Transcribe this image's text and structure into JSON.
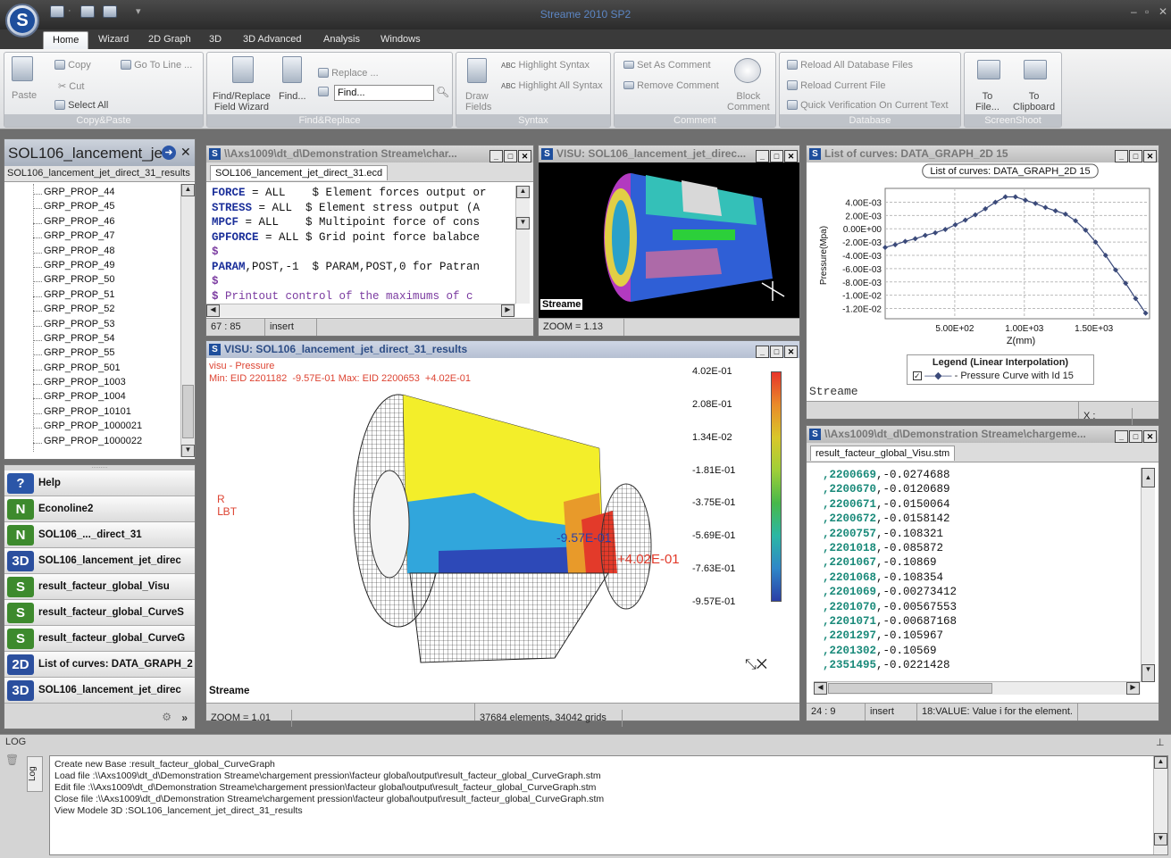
{
  "app": {
    "title": "Streame 2010 SP2",
    "logo_letter": "S"
  },
  "ribbon_tabs": [
    "Home",
    "Wizard",
    "2D Graph",
    "3D",
    "3D Advanced",
    "Analysis",
    "Windows"
  ],
  "ribbon": {
    "copy_paste": {
      "label": "Copy&Paste",
      "paste": "Paste",
      "copy": "Copy",
      "goto_line": "Go To Line ...",
      "cut": "Cut",
      "select_all": "Select All"
    },
    "find_replace": {
      "label": "Find&Replace",
      "find_replace_field_wizard": "Find/Replace\nField Wizard",
      "find": "Find...",
      "replace": "Replace ...",
      "find_input_value": "Find..."
    },
    "syntax": {
      "label": "Syntax",
      "draw_fields": "Draw\nFields",
      "highlight_syntax": "Highlight Syntax",
      "highlight_all_syntax": "Highlight All Syntax"
    },
    "comment": {
      "label": "Comment",
      "set_as_comment": "Set As Comment",
      "remove_comment": "Remove Comment",
      "block_comment": "Block\nComment"
    },
    "database": {
      "label": "Database",
      "reload_all": "Reload All Database Files",
      "reload_current": "Reload Current File",
      "quick_verification": "Quick Verification On Current Text"
    },
    "screenshoot": {
      "label": "ScreenShoot",
      "to_file": "To\nFile...",
      "to_clipboard": "To\nClipboard"
    }
  },
  "left_panel": {
    "title": "SOL106_lancement_je",
    "tab": "SOL106_lancement_jet_direct_31_results",
    "tree_items": [
      "GRP_PROP_44",
      "GRP_PROP_45",
      "GRP_PROP_46",
      "GRP_PROP_47",
      "GRP_PROP_48",
      "GRP_PROP_49",
      "GRP_PROP_50",
      "GRP_PROP_51",
      "GRP_PROP_52",
      "GRP_PROP_53",
      "GRP_PROP_54",
      "GRP_PROP_55",
      "GRP_PROP_501",
      "GRP_PROP_1003",
      "GRP_PROP_1004",
      "GRP_PROP_10101",
      "GRP_PROP_1000021",
      "GRP_PROP_1000022"
    ]
  },
  "nav_items": [
    {
      "icon": "?",
      "label": "Help",
      "color": "#2b56a8"
    },
    {
      "icon": "N",
      "label": "Econoline2",
      "color": "#3d8a2d"
    },
    {
      "icon": "N",
      "label": "SOL106_..._direct_31",
      "color": "#3d8a2d"
    },
    {
      "icon": "3D",
      "label": "SOL106_lancement_jet_direc",
      "color": "#2b4f9e"
    },
    {
      "icon": "S",
      "label": "result_facteur_global_Visu",
      "color": "#3d8a2d"
    },
    {
      "icon": "S",
      "label": "result_facteur_global_CurveS",
      "color": "#3d8a2d"
    },
    {
      "icon": "S",
      "label": "result_facteur_global_CurveG",
      "color": "#3d8a2d"
    },
    {
      "icon": "2D",
      "label": "List of curves: DATA_GRAPH_2",
      "color": "#2b4f9e"
    },
    {
      "icon": "3D",
      "label": "SOL106_lancement_jet_direc",
      "color": "#2b4f9e"
    }
  ],
  "editor": {
    "title": "\\\\Axs1009\\dt_d\\Demonstration Streame\\char...",
    "tab": "SOL106_lancement_jet_direct_31.ecd",
    "lines": [
      {
        "kw": "FORCE",
        "rest": " = ALL    $ Element forces output or"
      },
      {
        "kw": "STRESS",
        "rest": " = ALL  $ Element stress output (A"
      },
      {
        "kw": "MPCF",
        "rest": " = ALL    $ Multipoint force of cons"
      },
      {
        "kw": "GPFORCE",
        "rest": " = ALL $ Grid point force balabce"
      },
      {
        "kw": "$",
        "rest": ""
      },
      {
        "kw": "PARAM",
        "rest": ",POST,-1  $ PARAM,POST,0 for Patran"
      },
      {
        "kw": "$",
        "rest": ""
      },
      {
        "kw": "$",
        "rest": " Printout control of the maximums of c"
      }
    ],
    "status_pos": "67 : 85",
    "status_mode": "insert"
  },
  "visu_small": {
    "title": "VISU: SOL106_lancement_jet_direc...",
    "brand": "Streame",
    "zoom": "ZOOM = 1.13"
  },
  "visu_main": {
    "title": "VISU: SOL106_lancement_jet_direct_31_results",
    "subtitle": "visu - Pressure",
    "minmax": "Min: EID 2201182  -9.57E-01 Max: EID 2200653  +4.02E-01",
    "label_min": "-9.57E-01",
    "label_max": "+4.02E-01",
    "scale_values": [
      "4.02E-01",
      "2.08E-01",
      "1.34E-02",
      "-1.81E-01",
      "-3.75E-01",
      "-5.69E-01",
      "-7.63E-01",
      "-9.57E-01"
    ],
    "scale_colors": [
      "#e8352a",
      "#e98b2a",
      "#d9c72a",
      "#9fcf38",
      "#48b84a",
      "#2bb7a4",
      "#2f87c8",
      "#2b3fa6"
    ],
    "brand": "Streame",
    "zoom": "ZOOM = 1.01",
    "elements": "37684 elements, 34042 grids"
  },
  "curves": {
    "window_title": "List of curves: DATA_GRAPH_2D 15",
    "legend_title": "Legend (Linear Interpolation)",
    "legend_entry": "- Pressure Curve with Id 15",
    "brand": "Streame",
    "status_x": "X :"
  },
  "chart_data": {
    "type": "line",
    "title": "List of curves: DATA_GRAPH_2D 15",
    "xlabel": "Z(mm)",
    "ylabel": "Pressure(Mpa)",
    "xlim": [
      0,
      1900
    ],
    "ylim": [
      -0.013,
      0.005
    ],
    "x_ticks": [
      "5.00E+02",
      "1.00E+03",
      "1.50E+03"
    ],
    "x_tick_values": [
      500,
      1000,
      1500
    ],
    "y_ticks": [
      "4.00E-03",
      "2.00E-03",
      "0.00E+00",
      "-2.00E-03",
      "-4.00E-03",
      "-6.00E-03",
      "-8.00E-03",
      "-1.00E-02",
      "-1.20E-02"
    ],
    "y_tick_values": [
      0.004,
      0.002,
      0,
      -0.002,
      -0.004,
      -0.006,
      -0.008,
      -0.01,
      -0.012
    ],
    "grid": true,
    "legend_position": "bottom",
    "series": [
      {
        "name": "Pressure Curve with Id 15",
        "color": "#3b4a7a",
        "x": [
          0,
          72,
          144,
          216,
          288,
          360,
          432,
          504,
          576,
          648,
          720,
          792,
          864,
          936,
          1008,
          1080,
          1152,
          1224,
          1296,
          1368,
          1440,
          1512,
          1584,
          1656,
          1728,
          1800,
          1872
        ],
        "y": [
          -0.0028,
          -0.0024,
          -0.0019,
          -0.0015,
          -0.001,
          -0.0006,
          -0.0001,
          0.0006,
          0.0013,
          0.0021,
          0.003,
          0.004,
          0.0048,
          0.0048,
          0.0043,
          0.0038,
          0.0032,
          0.0027,
          0.0022,
          0.0012,
          -0.0002,
          -0.002,
          -0.004,
          -0.0062,
          -0.0082,
          -0.0105,
          -0.0127
        ]
      }
    ]
  },
  "result_window": {
    "title": "\\\\Axs1009\\dt_d\\Demonstration Streame\\chargeme...",
    "tab": "result_facteur_global_Visu.stm",
    "rows": [
      {
        "id": ",2200669",
        "val": ",-0.0274688"
      },
      {
        "id": ",2200670",
        "val": ",-0.0120689"
      },
      {
        "id": ",2200671",
        "val": ",-0.0150064"
      },
      {
        "id": ",2200672",
        "val": ",-0.0158142"
      },
      {
        "id": ",2200757",
        "val": ",-0.108321"
      },
      {
        "id": ",2201018",
        "val": ",-0.085872"
      },
      {
        "id": ",2201067",
        "val": ",-0.10869"
      },
      {
        "id": ",2201068",
        "val": ",-0.108354"
      },
      {
        "id": ",2201069",
        "val": ",-0.00273412"
      },
      {
        "id": ",2201070",
        "val": ",-0.00567553"
      },
      {
        "id": ",2201071",
        "val": ",-0.00687168"
      },
      {
        "id": ",2201297",
        "val": ",-0.105967"
      },
      {
        "id": ",2201302",
        "val": ",-0.10569"
      },
      {
        "id": ",2351495",
        "val": ",-0.0221428"
      }
    ],
    "status_pos": "24 : 9",
    "status_mode": "insert",
    "status_info": "18:VALUE: Value i for the element."
  },
  "log": {
    "title": "LOG",
    "side_tab": "Log",
    "lines": [
      "Create new Base :result_facteur_global_CurveGraph",
      "Load file :\\\\Axs1009\\dt_d\\Demonstration Streame\\chargement pression\\facteur global\\output\\result_facteur_global_CurveGraph.stm",
      "Edit file :\\\\Axs1009\\dt_d\\Demonstration Streame\\chargement pression\\facteur global\\output\\result_facteur_global_CurveGraph.stm",
      "Close file :\\\\Axs1009\\dt_d\\Demonstration Streame\\chargement pression\\facteur global\\output\\result_facteur_global_CurveGraph.stm",
      "View Modele 3D :SOL106_lancement_jet_direct_31_results"
    ]
  }
}
